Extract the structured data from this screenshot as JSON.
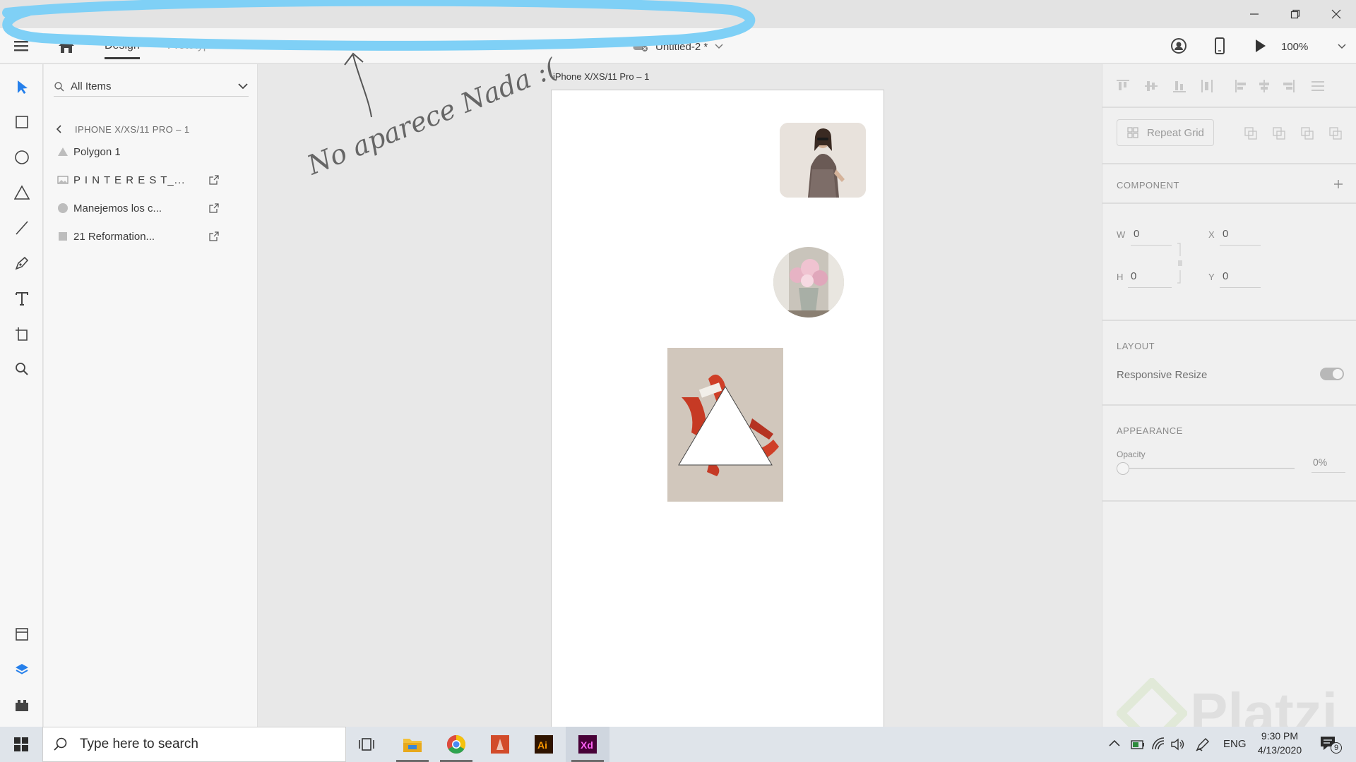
{
  "app": {
    "tabs": [
      "Design",
      "Prototype"
    ],
    "document_title": "Untitled-2 *",
    "zoom": "100%"
  },
  "layers": {
    "search_placeholder": "All Items",
    "breadcrumb": "IPHONE X/XS/11 PRO – 1",
    "items": [
      {
        "name": "Polygon 1",
        "icon": "triangle-icon"
      },
      {
        "name": "P I N T E R E S T_...",
        "icon": "image-icon"
      },
      {
        "name": "Manejemos los c...",
        "icon": "circle-icon"
      },
      {
        "name": "21 Reformation...",
        "icon": "rectangle-icon"
      }
    ]
  },
  "canvas": {
    "artboard_label": "iPhone X/XS/11 Pro – 1",
    "annotation": "No aparece Nada :("
  },
  "props": {
    "repeat_grid": "Repeat Grid",
    "component_label": "COMPONENT",
    "w_label": "W",
    "w_value": "0",
    "x_label": "X",
    "x_value": "0",
    "h_label": "H",
    "h_value": "0",
    "y_label": "Y",
    "y_value": "0",
    "layout_label": "LAYOUT",
    "responsive_resize": "Responsive Resize",
    "appearance_label": "APPEARANCE",
    "opacity_label": "Opacity",
    "opacity_value": "0%",
    "watermark": "Platzi"
  },
  "taskbar": {
    "search_placeholder": "Type here to search",
    "language": "ENG",
    "time": "9:30 PM",
    "date": "4/13/2020",
    "notification_count": "9"
  },
  "colors": {
    "accent": "#2680eb",
    "scribble": "#7fd0f6",
    "xd": "#470137",
    "xd_text": "#ff61f6",
    "illustrator": "#2f1400",
    "illustrator_text": "#ff9a00"
  }
}
